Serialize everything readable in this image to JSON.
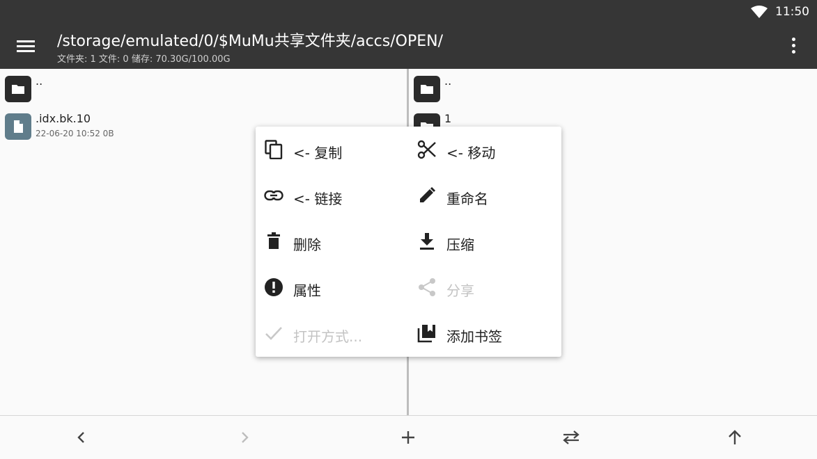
{
  "status_bar": {
    "time": "11:50"
  },
  "toolbar": {
    "path": "/storage/emulated/0/$MuMu共享文件夹/accs/OPEN/",
    "info": "文件夹: 1  文件: 0  储存: 70.30G/100.00G",
    "menu_icon": "hamburger-icon",
    "overflow_icon": "more-vert-icon"
  },
  "left_pane": {
    "items": [
      {
        "name": "..",
        "meta": "",
        "icon": "folder-icon"
      },
      {
        "name": ".idx.bk.10",
        "meta": "22-06-20 10:52  0B",
        "icon": "file-icon"
      }
    ]
  },
  "right_pane": {
    "items": [
      {
        "name": "..",
        "icon": "folder-icon"
      },
      {
        "name": "1",
        "icon": "folder-icon"
      }
    ]
  },
  "context_menu": {
    "copy": "<- 复制",
    "move": "<- 移动",
    "link": "<- 链接",
    "rename": "重命名",
    "delete": "删除",
    "compress": "压缩",
    "properties": "属性",
    "share": "分享",
    "open_with": "打开方式...",
    "add_bookmark": "添加书签"
  },
  "colors": {
    "bar": "#363636",
    "accent_doc": "#607d8b"
  }
}
